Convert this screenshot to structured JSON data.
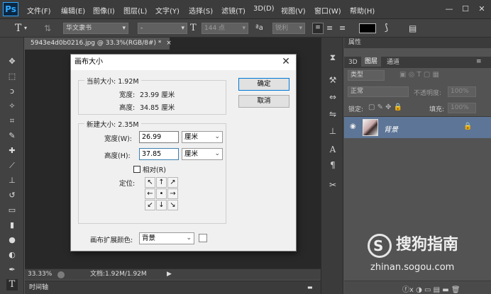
{
  "app": {
    "logo": "Ps"
  },
  "menu": [
    "文件(F)",
    "编辑(E)",
    "图像(I)",
    "图层(L)",
    "文字(Y)",
    "选择(S)",
    "滤镜(T)",
    "3D(D)",
    "视图(V)",
    "窗口(W)",
    "帮助(H)"
  ],
  "window_controls": {
    "minimize": "—",
    "maximize": "☐",
    "close": "✕"
  },
  "options": {
    "font_family": "华文隶书",
    "font_style": "-",
    "font_size": "144 点",
    "aa_label": "ªa",
    "antialias": "锐利"
  },
  "document": {
    "tab_title": "5943e4d0b0216.jpg @ 33.3%(RGB/8#) *",
    "tab_close": "×"
  },
  "status": {
    "zoom": "33.33%",
    "doc_size": "文档:1.92M/1.92M"
  },
  "timeline": {
    "label": "时间轴"
  },
  "dialog": {
    "title": "画布大小",
    "current": {
      "label": "当前大小: 1.92M",
      "width_label": "宽度:",
      "width_value": "23.99 厘米",
      "height_label": "高度:",
      "height_value": "34.85 厘米"
    },
    "new": {
      "label": "新建大小: 2.35M",
      "width_label": "宽度(W):",
      "width_value": "26.99",
      "width_unit": "厘米",
      "height_label": "高度(H):",
      "height_value": "37.85",
      "height_unit": "厘米",
      "relative_label": "相对(R)",
      "relative_checked": false,
      "anchor_label": "定位:"
    },
    "extension_label": "画布扩展颜色:",
    "extension_value": "背景",
    "ok": "确定",
    "cancel": "取消"
  },
  "panels": {
    "top_tabs": [
      "属性"
    ],
    "layer_tabs": [
      "3D",
      "图层",
      "通道"
    ],
    "kind_filter": "类型",
    "blend_mode": "正常",
    "opacity_label": "不透明度:",
    "opacity_value": "100%",
    "lock_label": "锁定:",
    "fill_label": "填充:",
    "fill_value": "100%",
    "layer_name": "背景"
  },
  "watermark": {
    "brand": "搜狗指南",
    "url": "zhinan.sogou.com"
  },
  "colors": {
    "accent": "#31a8ff",
    "selected_layer": "#5d7596",
    "dialog_bg": "#f0f0f0"
  }
}
